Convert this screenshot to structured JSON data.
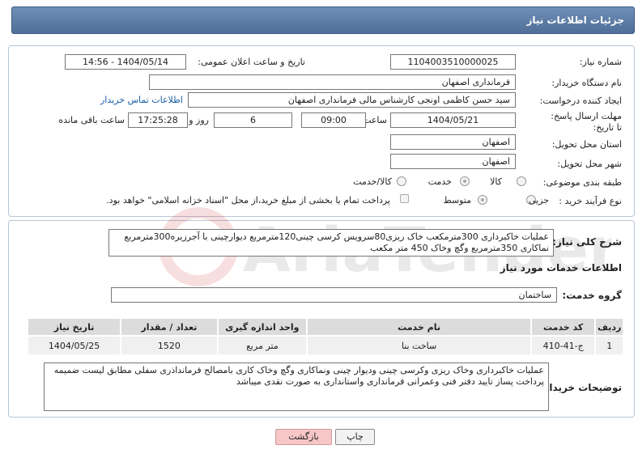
{
  "header": {
    "title": "جزئیات اطلاعات نیاز"
  },
  "fields": {
    "need_number_label": "شماره نیاز:",
    "need_number": "1104003510000025",
    "announce_label": "تاریخ و ساعت اعلان عمومی:",
    "announce_value": "1404/05/14 - 14:56",
    "buyer_org_label": "نام دستگاه خریدار:",
    "buyer_org": "فرمانداری اصفهان",
    "creator_label": "ایجاد کننده درخواست:",
    "creator": "سید حسن  کاظمی اونجی کارشناس مالی  فرمانداری اصفهان",
    "contact_link": "اطلاعات تماس خریدار",
    "deadline_label": "مهلت ارسال پاسخ: تا تاریخ:",
    "deadline_date": "1404/05/21",
    "hour_label": "ساعت",
    "deadline_time": "09:00",
    "days_value": "6",
    "days_label": "روز و",
    "remaining_time": "17:25:28",
    "remaining_label": "ساعت باقی مانده",
    "province_label": "استان محل تحویل:",
    "province": "اصفهان",
    "city_label": "شهر محل تحویل:",
    "city": "اصفهان",
    "category_label": "طبقه بندی موضوعی:",
    "category_options": [
      "کالا",
      "خدمت",
      "کالا/خدمت"
    ],
    "purchase_type_label": "نوع فرآیند خرید :",
    "purchase_type_options": [
      "جزیی",
      "متوسط"
    ],
    "treasury_note": "پرداخت تمام یا بخشی از مبلغ خرید،از محل \"اسناد خزانه اسلامی\" خواهد بود."
  },
  "description": {
    "label": "شرح کلی نیاز:",
    "text": "عملیات خاکبرداری 300مترمکعب خاک ریزی80سرویس کرسی چینی120مترمربع دیوارچینی با آجرزیره300مترمربع نماکاری 350مترمربع وگچ وخاک 450 متر مکعب"
  },
  "services": {
    "section_title": "اطلاعات خدمات مورد نیاز",
    "group_label": "گروه خدمت:",
    "group_value": "ساختمان",
    "columns": [
      "ردیف",
      "کد خدمت",
      "نام خدمت",
      "واحد اندازه گیری",
      "تعداد / مقدار",
      "تاریخ نیاز"
    ],
    "rows": [
      [
        "1",
        "ج-41-410",
        "ساخت بنا",
        "متر مربع",
        "1520",
        "1404/05/25"
      ]
    ]
  },
  "buyer_notes": {
    "label": "توضیحات خریدار:",
    "text": "عملیات خاکبرداری وخاک ریزی وکرسی چینی ودیوار چینی ونماکاری وگچ  وخاک کاری بامصالح فرمانداذری سفلی مطابق لیست ضمیمه پرداخت پساز تایید دفتر فنی وعمرانی فرمانداری واستانداری به صورت نقدی میباشد"
  },
  "buttons": {
    "print": "چاپ",
    "back": "بازگشت"
  },
  "watermark_text": "AriaTender.net"
}
